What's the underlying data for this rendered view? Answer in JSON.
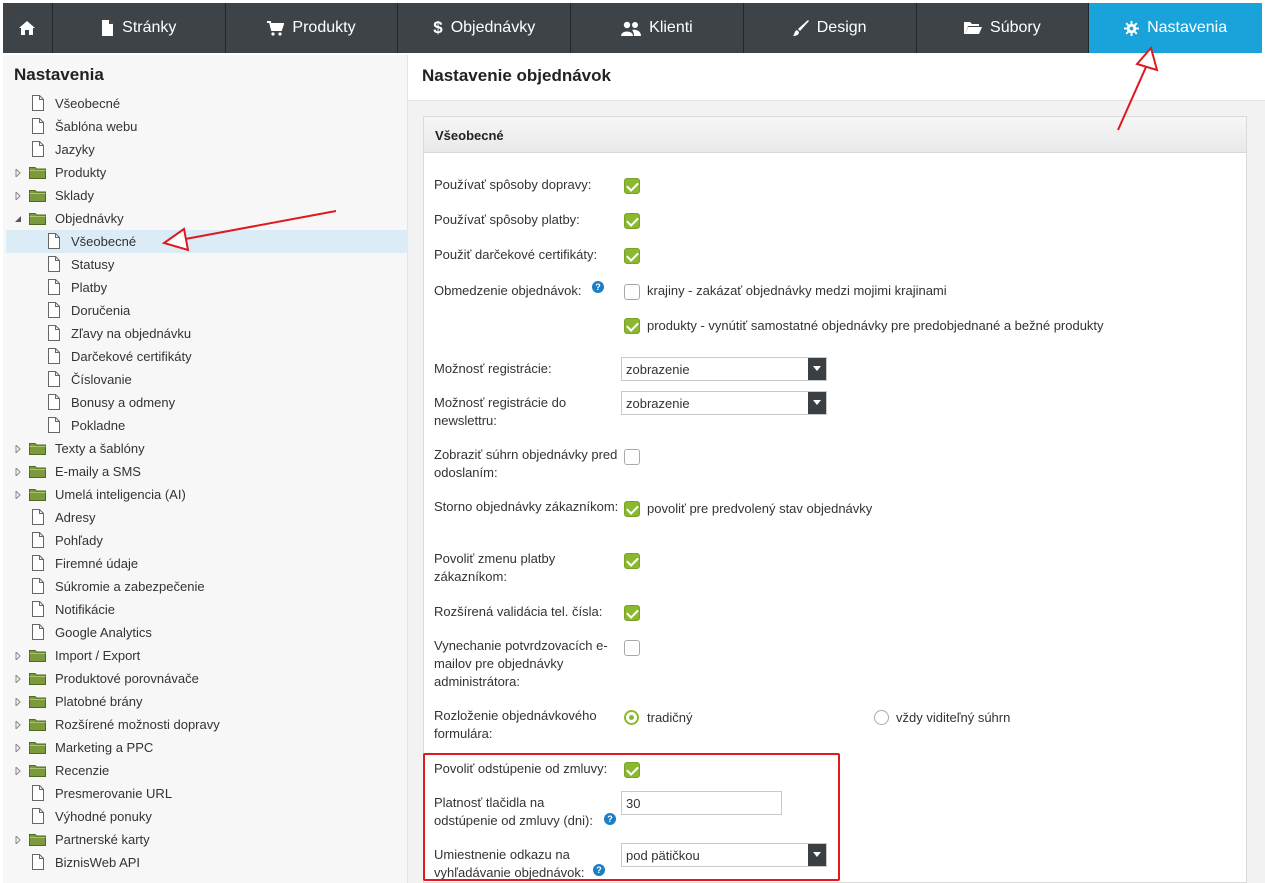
{
  "nav": {
    "tabs": [
      {
        "label": "Stránky",
        "icon": "file-icon"
      },
      {
        "label": "Produkty",
        "icon": "cart-icon"
      },
      {
        "label": "Objednávky",
        "icon": "dollar-icon"
      },
      {
        "label": "Klienti",
        "icon": "users-icon"
      },
      {
        "label": "Design",
        "icon": "brush-icon"
      },
      {
        "label": "Súbory",
        "icon": "folder-open-icon"
      },
      {
        "label": "Nastavenia",
        "icon": "gear-icon",
        "active": true
      }
    ],
    "active_color": "#1aa3db",
    "bar_color": "#3d4347"
  },
  "sidebar": {
    "title": "Nastavenia",
    "items": [
      {
        "label": "Všeobecné",
        "type": "page"
      },
      {
        "label": "Šablóna webu",
        "type": "page"
      },
      {
        "label": "Jazyky",
        "type": "page"
      },
      {
        "label": "Produkty",
        "type": "folder",
        "expanded": false
      },
      {
        "label": "Sklady",
        "type": "folder",
        "expanded": false
      },
      {
        "label": "Objednávky",
        "type": "folder",
        "expanded": true
      },
      {
        "label": "Všeobecné",
        "type": "page",
        "selected": true
      },
      {
        "label": "Statusy",
        "type": "page"
      },
      {
        "label": "Platby",
        "type": "page"
      },
      {
        "label": "Doručenia",
        "type": "page"
      },
      {
        "label": "Zľavy na objednávku",
        "type": "page"
      },
      {
        "label": "Darčekové certifikáty",
        "type": "page"
      },
      {
        "label": "Číslovanie",
        "type": "page"
      },
      {
        "label": "Bonusy a odmeny",
        "type": "page"
      },
      {
        "label": "Pokladne",
        "type": "page"
      },
      {
        "label": "Texty a šablóny",
        "type": "folder",
        "expanded": false
      },
      {
        "label": "E-maily a SMS",
        "type": "folder",
        "expanded": false
      },
      {
        "label": "Umelá inteligencia (AI)",
        "type": "folder",
        "expanded": false
      },
      {
        "label": "Adresy",
        "type": "page"
      },
      {
        "label": "Pohľady",
        "type": "page"
      },
      {
        "label": "Firemné údaje",
        "type": "page"
      },
      {
        "label": "Súkromie a zabezpečenie",
        "type": "page"
      },
      {
        "label": "Notifikácie",
        "type": "page"
      },
      {
        "label": "Google Analytics",
        "type": "page"
      },
      {
        "label": "Import / Export",
        "type": "folder",
        "expanded": false
      },
      {
        "label": "Produktové porovnávače",
        "type": "folder",
        "expanded": false
      },
      {
        "label": "Platobné brány",
        "type": "folder",
        "expanded": false
      },
      {
        "label": "Rozšírené možnosti dopravy",
        "type": "folder",
        "expanded": false
      },
      {
        "label": "Marketing a PPC",
        "type": "folder",
        "expanded": false
      },
      {
        "label": "Recenzie",
        "type": "folder",
        "expanded": false
      },
      {
        "label": "Presmerovanie URL",
        "type": "page"
      },
      {
        "label": "Výhodné ponuky",
        "type": "page"
      },
      {
        "label": "Partnerské karty",
        "type": "folder",
        "expanded": false
      },
      {
        "label": "BiznisWeb API",
        "type": "page"
      }
    ]
  },
  "main": {
    "title": "Nastavenie objednávok",
    "panel_title": "Všeobecné",
    "fields": {
      "shipping": {
        "label": "Používať spôsoby dopravy:",
        "checked": true
      },
      "payment": {
        "label": "Používať spôsoby platby:",
        "checked": true
      },
      "gift_cert": {
        "label": "Použiť darčekové certifikáty:",
        "checked": true
      },
      "restriction": {
        "label": "Obmedzenie objednávok:",
        "opt1": {
          "text": "krajiny - zakázať objednávky medzi mojimi krajinami",
          "checked": false
        },
        "opt2": {
          "text": "produkty - vynútiť samostatné objednávky pre predobjednané a bežné produkty",
          "checked": true
        }
      },
      "registration": {
        "label": "Možnosť registrácie:",
        "value": "zobrazenie"
      },
      "newsletter": {
        "label": "Možnosť registrácie do newslettru:",
        "value": "zobrazenie"
      },
      "summary": {
        "label": "Zobraziť súhrn objednávky pred odoslaním:",
        "checked": false
      },
      "storno": {
        "label": "Storno objednávky zákazníkom:",
        "checked": true,
        "text": "povoliť pre predvolený stav objednávky"
      },
      "payment_change": {
        "label": "Povoliť zmenu platby zákazníkom:",
        "checked": true
      },
      "phone_validation": {
        "label": "Rozšírená validácia tel. čísla:",
        "checked": true
      },
      "skip_emails": {
        "label": "Vynechanie potvrdzovacích e-mailov pre objednávky administrátora:",
        "checked": false
      },
      "layout": {
        "label": "Rozloženie objednávkového formulára:",
        "opt1": "tradičný",
        "opt2": "vždy viditeľný súhrn",
        "selected": "tradičný"
      },
      "withdrawal": {
        "label": "Povoliť odstúpenie od zmluvy:",
        "checked": true
      },
      "withdrawal_days": {
        "label": "Platnosť tlačidla na odstúpenie od zmluvy (dni):",
        "value": "30"
      },
      "link_position": {
        "label": "Umiestnenie odkazu na vyhľadávanie objednávok:",
        "value": "pod pätičkou"
      }
    },
    "check_color": "#8ab82e",
    "highlight_color": "#e0191e"
  }
}
